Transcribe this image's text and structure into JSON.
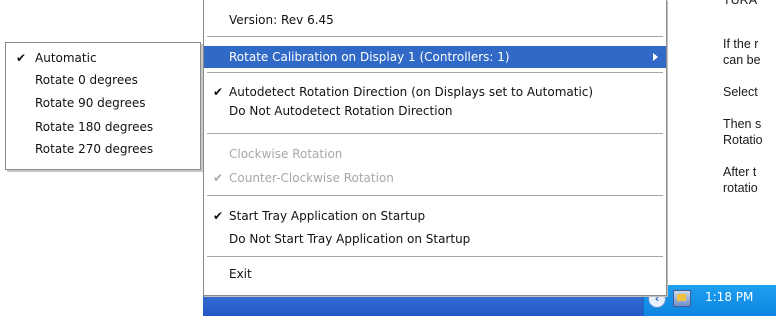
{
  "background_doc": {
    "lines": [
      "TURA",
      "If the r",
      "can be",
      "Select",
      "Then s",
      "Rotatio",
      "After t",
      "rotatio"
    ]
  },
  "main_menu": {
    "items": [
      {
        "label": "Version:  Rev 6.45",
        "checked": false,
        "disabled": false
      },
      {
        "label": "Rotate Calibration on Display 1 (Controllers: 1)",
        "checked": false,
        "disabled": false,
        "highlighted": true,
        "has_submenu": true
      },
      {
        "label": "Autodetect Rotation Direction (on Displays set to Automatic)",
        "checked": true,
        "disabled": false
      },
      {
        "label": "Do Not Autodetect Rotation Direction",
        "checked": false,
        "disabled": false
      },
      {
        "label": "Clockwise Rotation",
        "checked": false,
        "disabled": true
      },
      {
        "label": "Counter-Clockwise Rotation",
        "checked": true,
        "disabled": true
      },
      {
        "label": "Start Tray Application on Startup",
        "checked": true,
        "disabled": false
      },
      {
        "label": "Do Not Start Tray Application on Startup",
        "checked": false,
        "disabled": false
      },
      {
        "label": "Exit",
        "checked": false,
        "disabled": false
      }
    ]
  },
  "submenu": {
    "items": [
      {
        "label": "Automatic",
        "checked": true
      },
      {
        "label": "Rotate 0 degrees",
        "checked": false
      },
      {
        "label": "Rotate 90 degrees",
        "checked": false
      },
      {
        "label": "Rotate 180 degrees",
        "checked": false
      },
      {
        "label": "Rotate 270 degrees",
        "checked": false
      }
    ]
  },
  "checkmark": "✔",
  "taskbar": {
    "clock": "1:18 PM",
    "chevron": "‹",
    "icons": [
      "show-hidden-icons-chevron-icon",
      "tray-app-icon"
    ],
    "colors": {
      "taskbar": "#2f63cf",
      "tray": "#1491e8",
      "highlight": "#3169c6"
    }
  }
}
